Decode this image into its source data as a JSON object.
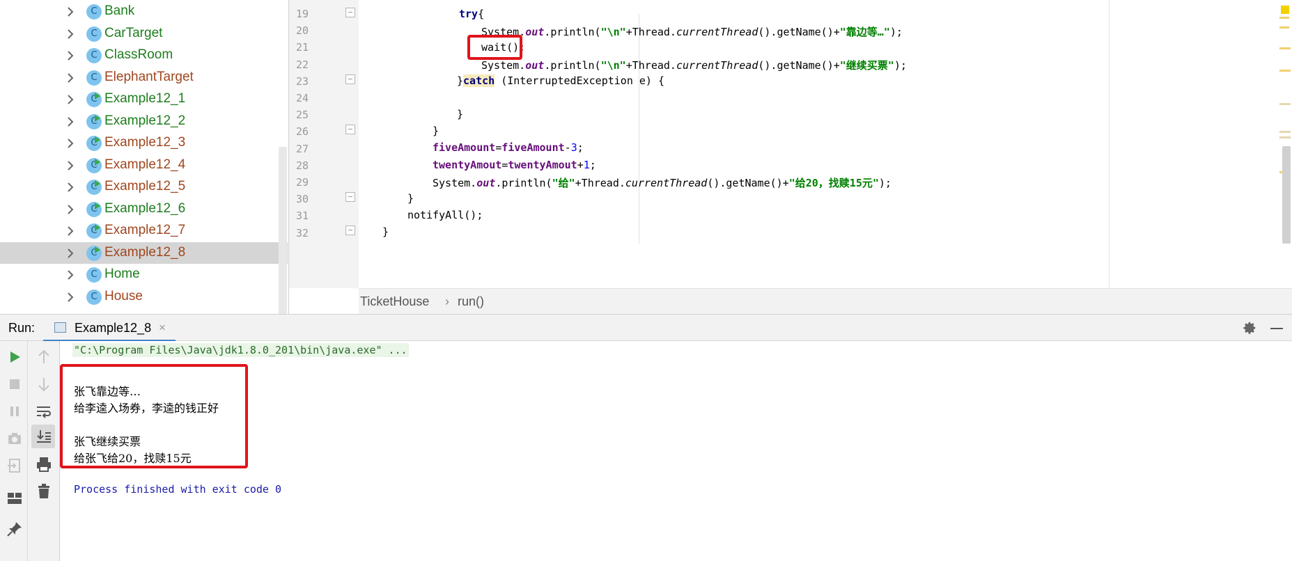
{
  "project_tree": {
    "items": [
      {
        "label": "Bank",
        "color": "#1d7d1d",
        "runnable": false,
        "selected": false
      },
      {
        "label": "CarTarget",
        "color": "#1d7d1d",
        "runnable": false,
        "selected": false
      },
      {
        "label": "ClassRoom",
        "color": "#1d7d1d",
        "runnable": false,
        "selected": false
      },
      {
        "label": "ElephantTarget",
        "color": "#a0461e",
        "runnable": false,
        "selected": false
      },
      {
        "label": "Example12_1",
        "color": "#1d7d1d",
        "runnable": true,
        "selected": false
      },
      {
        "label": "Example12_2",
        "color": "#1d7d1d",
        "runnable": true,
        "selected": false
      },
      {
        "label": "Example12_3",
        "color": "#a0461e",
        "runnable": true,
        "selected": false
      },
      {
        "label": "Example12_4",
        "color": "#a0461e",
        "runnable": true,
        "selected": false
      },
      {
        "label": "Example12_5",
        "color": "#a0461e",
        "runnable": true,
        "selected": false
      },
      {
        "label": "Example12_6",
        "color": "#1d7d1d",
        "runnable": true,
        "selected": false
      },
      {
        "label": "Example12_7",
        "color": "#a0461e",
        "runnable": true,
        "selected": false
      },
      {
        "label": "Example12_8",
        "color": "#a0461e",
        "runnable": true,
        "selected": true
      },
      {
        "label": "Home",
        "color": "#1d7d1d",
        "runnable": false,
        "selected": false
      },
      {
        "label": "House",
        "color": "#a0461e",
        "runnable": false,
        "selected": false
      }
    ],
    "class_glyph": "C"
  },
  "editor": {
    "line_numbers": [
      "19",
      "20",
      "21",
      "22",
      "23",
      "24",
      "25",
      "26",
      "27",
      "28",
      "29",
      "30",
      "31",
      "32"
    ],
    "code": {
      "l19_kw": "try",
      "l19_rest": "{",
      "l20_a": "System.",
      "l20_out": "out",
      "l20_b": ".println(",
      "l20_s1": "\"\\n\"",
      "l20_c": "+Thread.",
      "l20_ct": "currentThread",
      "l20_d": "().getName()+",
      "l20_s2": "\"靠边等…\"",
      "l20_e": ");",
      "l21": "wait();",
      "l22_a": "System.",
      "l22_out": "out",
      "l22_b": ".println(",
      "l22_s1": "\"\\n\"",
      "l22_c": "+Thread.",
      "l22_ct": "currentThread",
      "l22_d": "().getName()+",
      "l22_s2": "\"继续买票\"",
      "l22_e": ");",
      "l23_a": "}",
      "l23_kw": "catch",
      "l23_b": " (InterruptedException e) {",
      "l25": "}",
      "l26": "}",
      "l27_f1": "fiveAmount",
      "l27_eq": "=",
      "l27_f2": "fiveAmount",
      "l27_op": "-",
      "l27_n": "3",
      "l27_end": ";",
      "l28_f1": "twentyAmout",
      "l28_eq": "=",
      "l28_f2": "twentyAmout",
      "l28_op": "+",
      "l28_n": "1",
      "l28_end": ";",
      "l29_a": "System.",
      "l29_out": "out",
      "l29_b": ".println(",
      "l29_s1": "\"给\"",
      "l29_c": "+Thread.",
      "l29_ct": "currentThread",
      "l29_d": "().getName()+",
      "l29_s2": "\"给20，找赎15元\"",
      "l29_e": ");",
      "l30": "}",
      "l31": "notifyAll();",
      "l32": "}"
    },
    "breadcrumb": [
      "TicketHouse",
      "run()"
    ],
    "breadcrumb_separator": "›"
  },
  "run_window": {
    "label": "Run:",
    "tab_label": "Example12_8",
    "tab_close": "×",
    "icons": [
      "settings-gear-icon",
      "minimize-icon"
    ],
    "toolbar": [
      "rerun-icon",
      "stop-icon",
      "pause-icon",
      "screenshot-icon",
      "restore-layout-icon",
      "layout-icon",
      "pin-icon",
      "up-arrow-icon",
      "down-arrow-icon",
      "soft-wrap-icon",
      "scroll-to-end-icon",
      "print-icon",
      "trash-icon"
    ]
  },
  "console": {
    "command": "\"C:\\Program Files\\Java\\jdk1.8.0_201\\bin\\java.exe\" ...",
    "output_lines": [
      "张飞靠边等…",
      "给李逵入场券，李逵的钱正好",
      "",
      "张飞继续买票",
      "给张飞给20，找赎15元"
    ],
    "exit_message": "Process finished with exit code 0"
  },
  "colors": {
    "highlight_box": "#e0141b",
    "keyword": "#000080",
    "string": "#008000",
    "field": "#660e7a",
    "tab_underline": "#4083c9"
  }
}
